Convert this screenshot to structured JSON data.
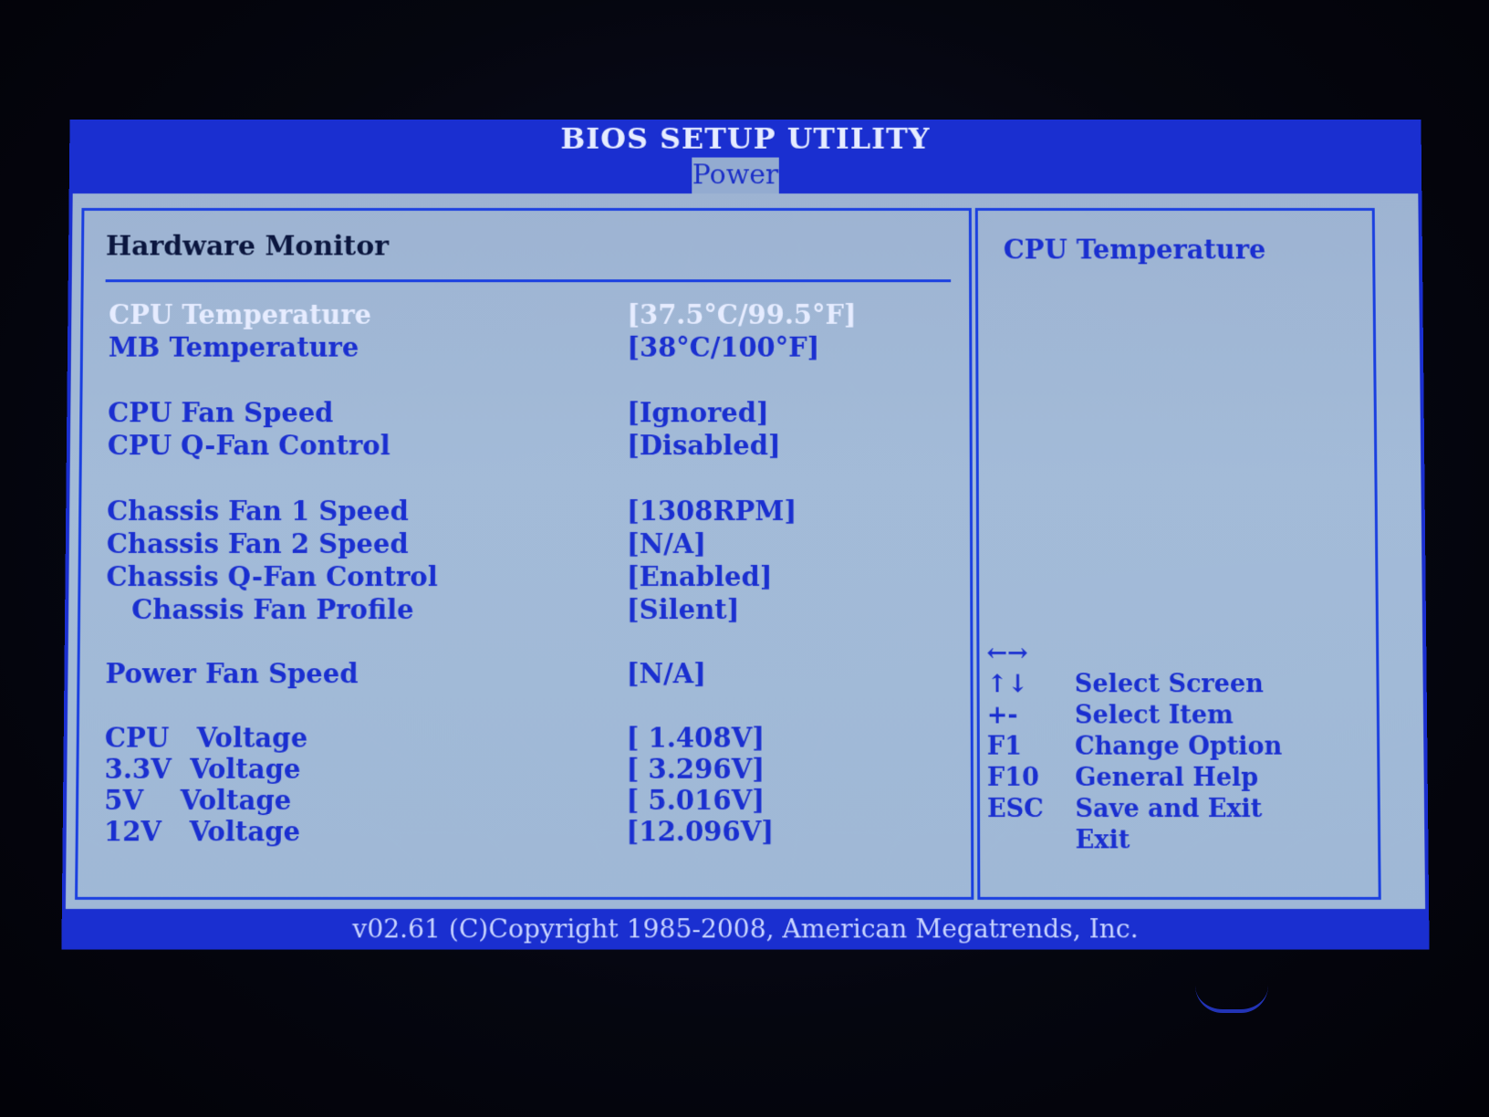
{
  "header": {
    "title": "BIOS SETUP UTILITY",
    "active_tab": "Power"
  },
  "main": {
    "section_title": "Hardware Monitor",
    "rows": [
      {
        "label": "CPU Temperature",
        "value": "[37.5°C/99.5°F]",
        "selected": true
      },
      {
        "label": "MB Temperature",
        "value": "[38°C/100°F]"
      },
      {
        "label": "CPU Fan Speed",
        "value": "[Ignored]"
      },
      {
        "label": "CPU Q-Fan Control",
        "value": "[Disabled]"
      },
      {
        "label": "Chassis Fan 1 Speed",
        "value": "[1308RPM]"
      },
      {
        "label": "Chassis Fan 2 Speed",
        "value": "[N/A]"
      },
      {
        "label": "Chassis Q-Fan Control",
        "value": "[Enabled]"
      },
      {
        "label": "Chassis Fan Profile",
        "value": "[Silent]",
        "indent": true
      },
      {
        "label": "Power Fan Speed",
        "value": "[N/A]"
      },
      {
        "label": "CPU   Voltage",
        "value": "[ 1.408V]"
      },
      {
        "label": "3.3V  Voltage",
        "value": "[ 3.296V]"
      },
      {
        "label": "5V    Voltage",
        "value": "[ 5.016V]"
      },
      {
        "label": "12V   Voltage",
        "value": "[12.096V]"
      }
    ]
  },
  "help": {
    "title": "CPU Temperature",
    "keys": [
      {
        "key": "←→",
        "desc": "Select Screen"
      },
      {
        "key": "↑↓",
        "desc": "Select Item"
      },
      {
        "key": "+-",
        "desc": "Change Option"
      },
      {
        "key": "F1",
        "desc": "General Help"
      },
      {
        "key": "F10",
        "desc": "Save and Exit"
      },
      {
        "key": "ESC",
        "desc": "Exit"
      }
    ]
  },
  "footer": {
    "text": "v02.61 (C)Copyright 1985-2008, American Megatrends, Inc."
  },
  "colors": {
    "bios_blue": "#1a2fd0",
    "panel_grey": "#9db3d2",
    "highlight_text": "#e6ecff"
  }
}
